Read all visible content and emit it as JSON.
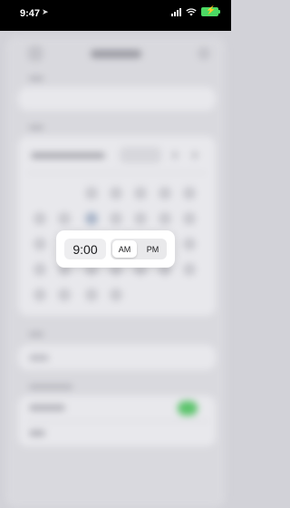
{
  "status_bar": {
    "time": "9:47",
    "location_icon": "location-arrow-icon",
    "battery_color": "#4cd964"
  },
  "time_picker": {
    "value": "9:00",
    "am_label": "AM",
    "pm_label": "PM",
    "selected_period": "AM"
  }
}
